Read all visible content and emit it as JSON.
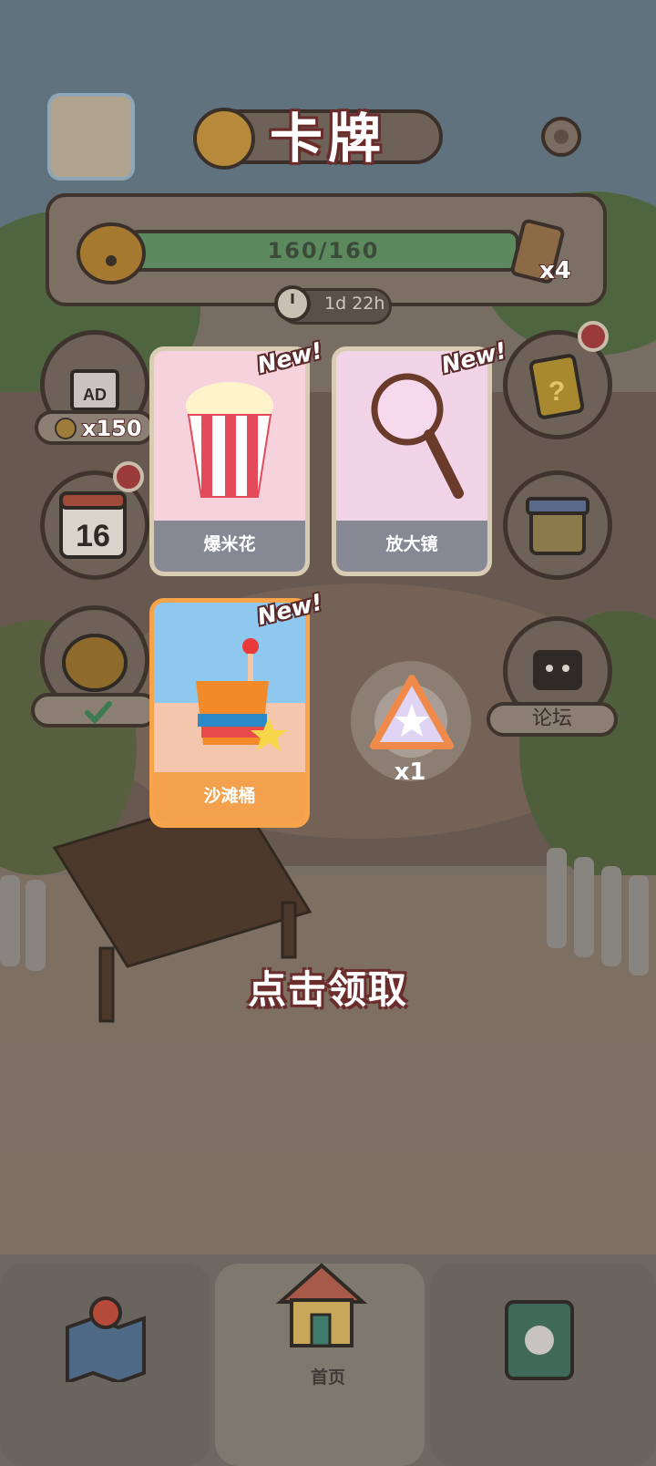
{
  "header": {
    "title": "卡牌"
  },
  "progress": {
    "text": "160/160",
    "fraction": 1.0,
    "pack_count": "x4",
    "timer": "1d 22h"
  },
  "side_left": {
    "ad_reward": "x150"
  },
  "side_right": {
    "forum_label": "论坛"
  },
  "cards": [
    {
      "name": "爆米花",
      "tag": "New!",
      "icon": "popcorn-icon"
    },
    {
      "name": "放大镜",
      "tag": "New!",
      "icon": "magnifier-icon"
    },
    {
      "name": "沙滩桶",
      "tag": "New!",
      "icon": "beach-bucket-icon"
    }
  ],
  "reward": {
    "count": "x1",
    "icon": "star-shard-icon"
  },
  "prompt": "点击领取",
  "nav": {
    "home_label": "首页"
  },
  "colors": {
    "card_border": "#d8ccb2",
    "highlight_border": "#f6a34a",
    "label_gray": "#868894",
    "label_orange": "#f4a14d"
  }
}
